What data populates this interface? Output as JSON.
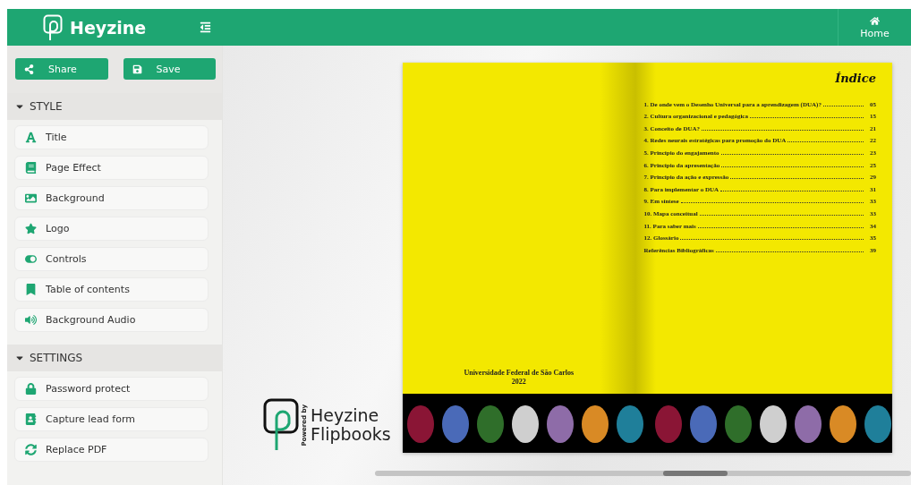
{
  "header": {
    "brand": "Heyzine",
    "home": "Home"
  },
  "actions": [
    "Share",
    "Save"
  ],
  "sections": [
    {
      "title": "STYLE",
      "expanded": true,
      "items": [
        "Title",
        "Page Effect",
        "Background",
        "Logo",
        "Controls",
        "Table of contents",
        "Background Audio"
      ]
    },
    {
      "title": "SETTINGS",
      "expanded": true,
      "items": [
        "Password protect",
        "Capture lead form",
        "Replace PDF"
      ]
    }
  ],
  "book": {
    "left_page": {
      "institution": "Universidade Federal de São Carlos",
      "year": "2022"
    },
    "right_page": {
      "heading": "Índice",
      "entries": [
        {
          "title": "1.  De onde vem o Desenho Universal para a aprendizagem (DUA)?",
          "page": "05"
        },
        {
          "title": "2.  Cultura organizacional e pedagógica",
          "page": "15"
        },
        {
          "title": "3.  Conceito de DUA?",
          "page": "21"
        },
        {
          "title": "4.  Redes neurais estratégicas para promoção do DUA",
          "page": "22"
        },
        {
          "title": "5.  Princípio do engajamento",
          "page": "23"
        },
        {
          "title": "6. Princípio da apresentação",
          "page": "25"
        },
        {
          "title": "7. Princípio da ação e expressão",
          "page": "29"
        },
        {
          "title": "8. Para implementar o DUA",
          "page": "31"
        },
        {
          "title": "9. Em síntese",
          "page": "33"
        },
        {
          "title": "10.  Mapa conceitual",
          "page": "33"
        },
        {
          "title": "11. Para saber mais",
          "page": "34"
        },
        {
          "title": "12. Glossário",
          "page": "35"
        },
        {
          "title": "Referências Bibliográficas",
          "page": "39"
        }
      ]
    }
  },
  "powered_by": {
    "caption": "Powered by",
    "line1": "Heyzine",
    "line2": "Flipbooks"
  }
}
